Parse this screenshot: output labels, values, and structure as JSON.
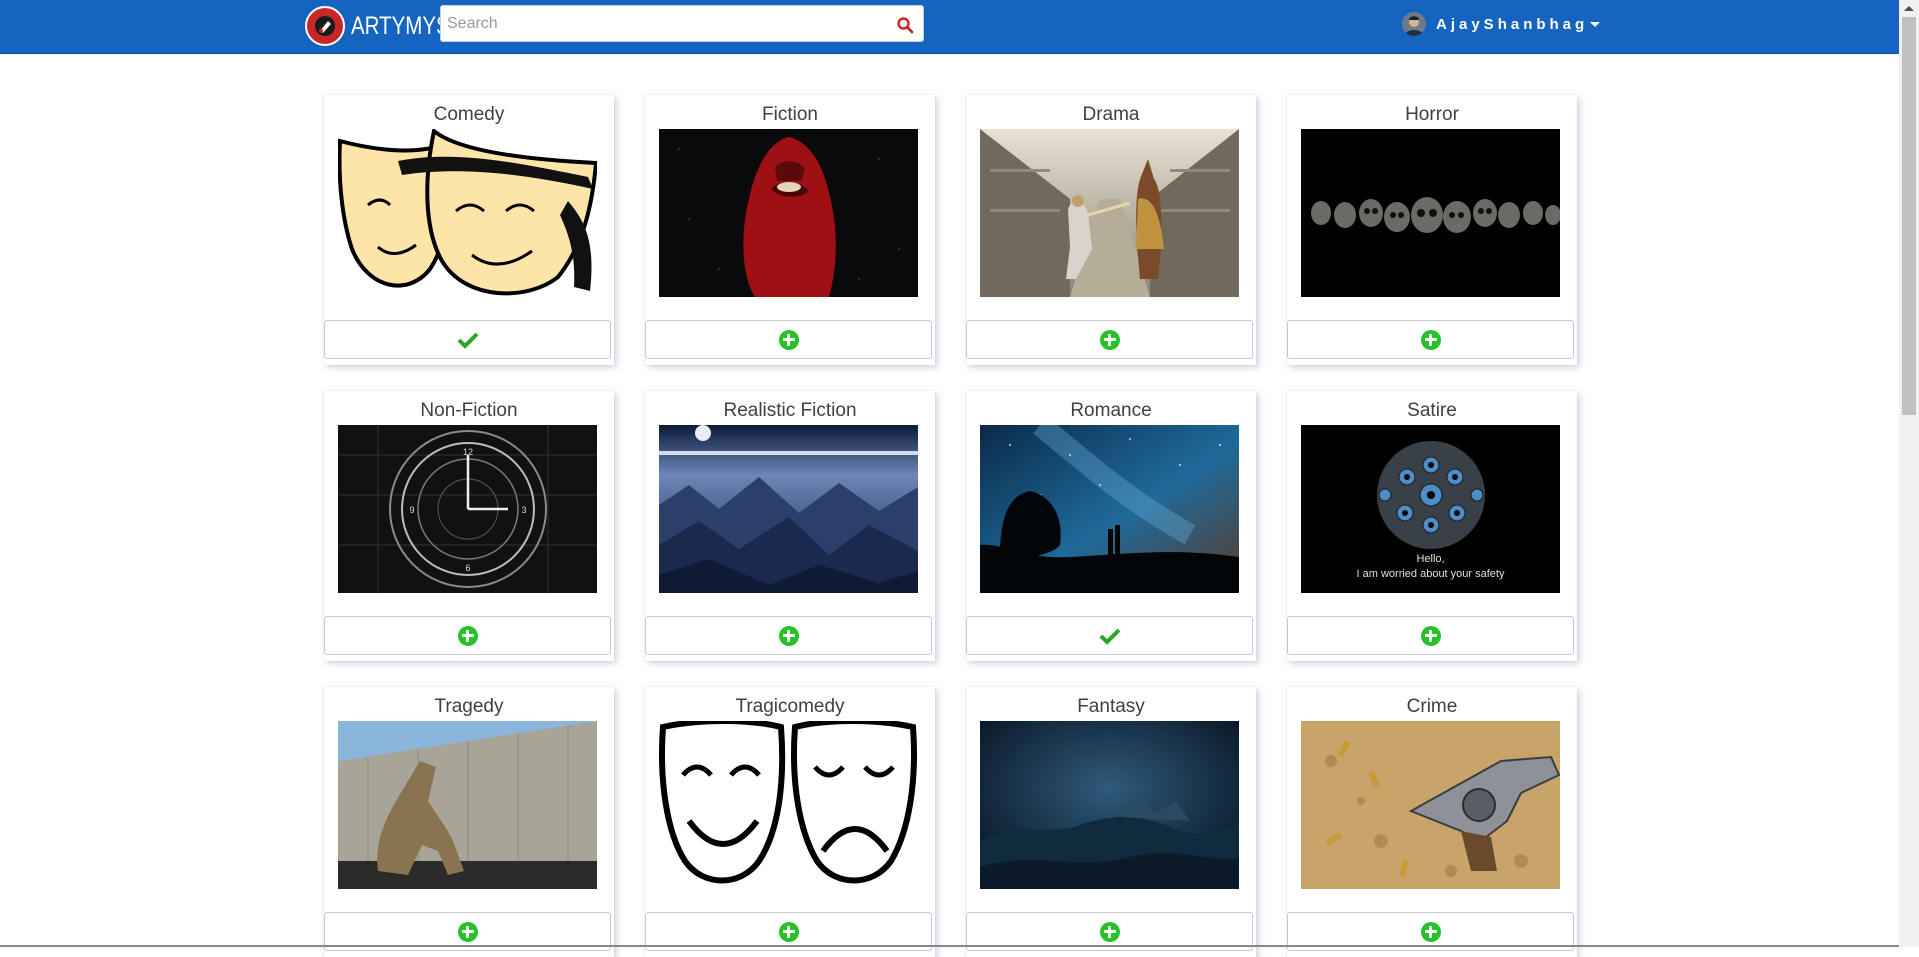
{
  "app": {
    "brand": "ARTYMYS",
    "colors": {
      "navbar": "#1565c0",
      "accent_green": "#27c227",
      "logo_red": "#c62828"
    }
  },
  "search": {
    "placeholder": "Search",
    "value": ""
  },
  "user": {
    "name": "AjayShanbhag",
    "avatar_icon": "avatar-icon",
    "menu_icon": "caret-down-icon"
  },
  "genres": [
    {
      "title": "Comedy",
      "selected": true,
      "image": "comedy-masks",
      "icon": "check-icon"
    },
    {
      "title": "Fiction",
      "selected": false,
      "image": "red-cloak-figure",
      "icon": "plus-circle-icon"
    },
    {
      "title": "Drama",
      "selected": false,
      "image": "dancers-street",
      "icon": "plus-circle-icon"
    },
    {
      "title": "Horror",
      "selected": false,
      "image": "skulls-row",
      "icon": "plus-circle-icon"
    },
    {
      "title": "Non-Fiction",
      "selected": false,
      "image": "clock-face",
      "icon": "plus-circle-icon"
    },
    {
      "title": "Realistic Fiction",
      "selected": false,
      "image": "blue-mountains",
      "icon": "plus-circle-icon"
    },
    {
      "title": "Romance",
      "selected": true,
      "image": "couple-milky-way",
      "icon": "check-icon"
    },
    {
      "title": "Satire",
      "selected": false,
      "image": "eyeball-sphere",
      "icon": "plus-circle-icon",
      "caption_lines": [
        "Hello,",
        "I am worried about your safety"
      ]
    },
    {
      "title": "Tragedy",
      "selected": false,
      "image": "sculpture-wall",
      "icon": "plus-circle-icon"
    },
    {
      "title": "Tragicomedy",
      "selected": false,
      "image": "happy-sad-masks",
      "icon": "plus-circle-icon"
    },
    {
      "title": "Fantasy",
      "selected": false,
      "image": "dark-blue-landscape",
      "icon": "plus-circle-icon"
    },
    {
      "title": "Crime",
      "selected": false,
      "image": "revolver-bullets",
      "icon": "plus-circle-icon"
    }
  ]
}
